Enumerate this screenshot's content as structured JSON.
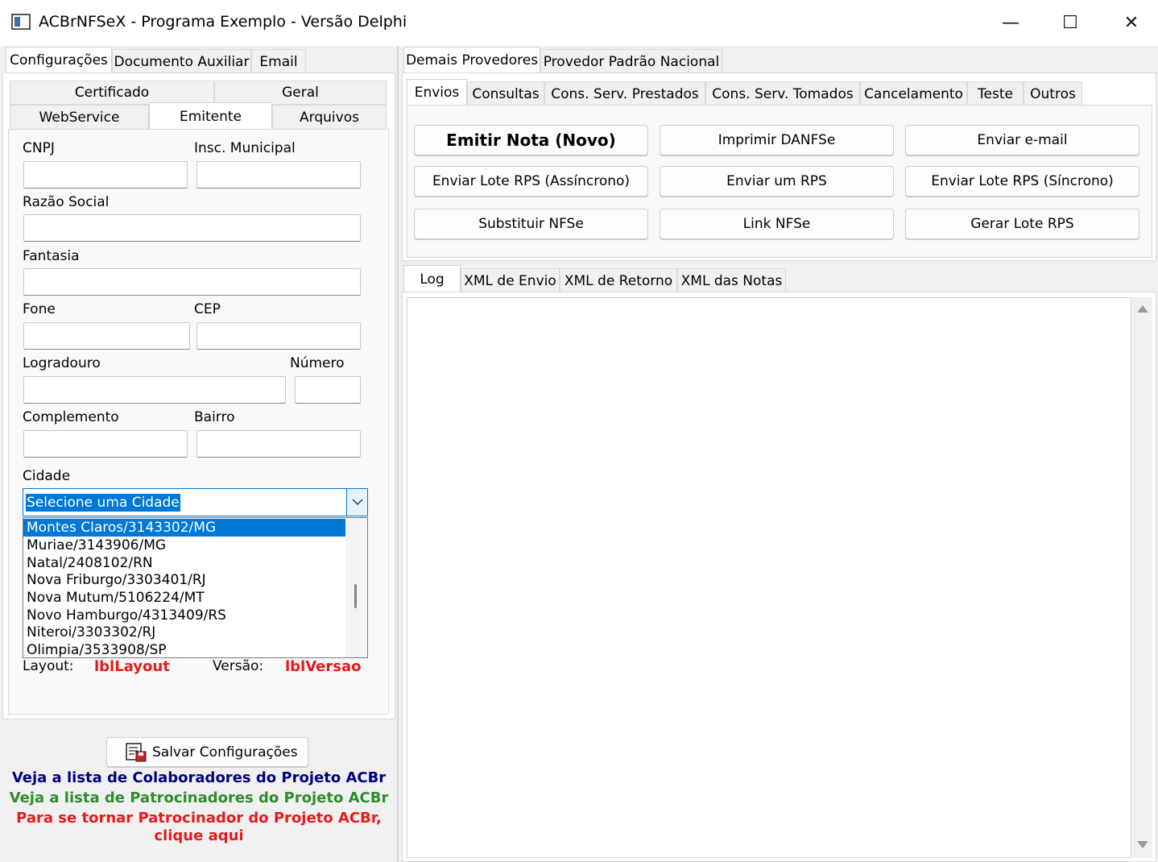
{
  "window": {
    "title": "ACBrNFSeX - Programa Exemplo - Versão Delphi",
    "min": "—",
    "max": "☐",
    "close": "✕"
  },
  "left": {
    "tabs": [
      "Configurações",
      "Documento Auxiliar",
      "Email"
    ],
    "subtabs_row1": [
      "Certificado",
      "Geral"
    ],
    "subtabs_row2": [
      "WebService",
      "Emitente",
      "Arquivos"
    ],
    "fields": {
      "cnpj": "CNPJ",
      "insc_municipal": "Insc. Municipal",
      "razao_social": "Razão Social",
      "fantasia": "Fantasia",
      "fone": "Fone",
      "cep": "CEP",
      "logradouro": "Logradouro",
      "numero": "Número",
      "complemento": "Complemento",
      "bairro": "Bairro",
      "cidade": "Cidade"
    },
    "cidade_value": "Selecione uma Cidade",
    "cidade_options": [
      "Montes Claros/3143302/MG",
      "Muriae/3143906/MG",
      "Natal/2408102/RN",
      "Nova Friburgo/3303401/RJ",
      "Nova Mutum/5106224/MT",
      "Novo Hamburgo/4313409/RS",
      "Niteroi/3303302/RJ",
      "Olimpia/3533908/SP"
    ],
    "layout_label": "Layout:",
    "layout_value": "lblLayout",
    "versao_label": "Versão:",
    "versao_value": "lblVersao",
    "save_button": "Salvar Configurações",
    "link_colaboradores": "Veja a lista de Colaboradores do Projeto ACBr",
    "link_patrocinadores": "Veja a lista de Patrocinadores do Projeto ACBr",
    "link_patrocinar_1": "Para se tornar Patrocinador do Projeto ACBr,",
    "link_patrocinar_2": "clique aqui"
  },
  "right": {
    "tabs": [
      "Demais Provedores",
      "Provedor Padrão Nacional"
    ],
    "subtabs": [
      "Envios",
      "Consultas",
      "Cons. Serv. Prestados",
      "Cons. Serv. Tomados",
      "Cancelamento",
      "Teste",
      "Outros"
    ],
    "buttons": [
      "Emitir Nota (Novo)",
      "Imprimir DANFSe",
      "Enviar e-mail",
      "Enviar Lote RPS (Assíncrono)",
      "Enviar um RPS",
      "Enviar Lote RPS (Síncrono)",
      "Substituir NFSe",
      "Link NFSe",
      "Gerar Lote RPS"
    ],
    "log_tabs": [
      "Log",
      "XML de Envio",
      "XML de Retorno",
      "XML das Notas"
    ]
  },
  "colors": {
    "selection": "#0078d7",
    "link_blue": "#00007f",
    "link_green": "#2e8b2e",
    "link_red": "#e41b1b"
  }
}
